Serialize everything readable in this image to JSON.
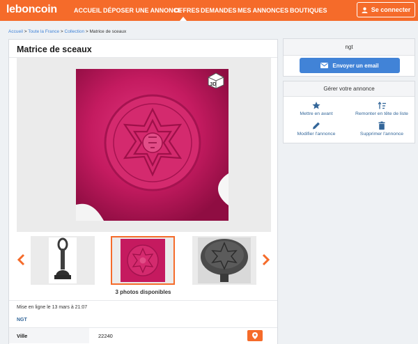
{
  "brand": {
    "name": "leboncoin",
    "accent": "#f56b2a",
    "link": "#336699",
    "button_blue": "#4183d7"
  },
  "nav": {
    "items": [
      {
        "label": "ACCUEIL"
      },
      {
        "label": "DÉPOSER UNE ANNONCE"
      },
      {
        "label": "OFFRES",
        "active": true
      },
      {
        "label": "DEMANDES"
      },
      {
        "label": "MES ANNONCES"
      },
      {
        "label": "BOUTIQUES"
      }
    ],
    "connect_label": "Se connecter",
    "connect_icon": "user-icon"
  },
  "breadcrumb": {
    "items": [
      "Accueil",
      "Toute la France",
      "Collection"
    ],
    "separator": ">",
    "current": "Matrice de sceaux"
  },
  "listing": {
    "title": "Matrice de sceaux",
    "photos_count": "3 photos disponibles",
    "posted": "Mise en ligne le 13 mars à 21:07",
    "seller": "NGT",
    "ville_label": "Ville",
    "ville_value": "22240",
    "badge_3d": "3D"
  },
  "contact": {
    "name": "ngt",
    "email_button": "Envoyer un email",
    "email_icon": "envelope-icon"
  },
  "manage": {
    "title": "Gérer votre annonce",
    "actions": [
      {
        "label": "Mettre en avant",
        "icon": "star-icon"
      },
      {
        "label": "Remonter en tête de liste",
        "icon": "sort-up-icon"
      },
      {
        "label": "Modifier l'annonce",
        "icon": "pencil-icon"
      },
      {
        "label": "Supprimer l'annonce",
        "icon": "trash-icon"
      }
    ]
  }
}
